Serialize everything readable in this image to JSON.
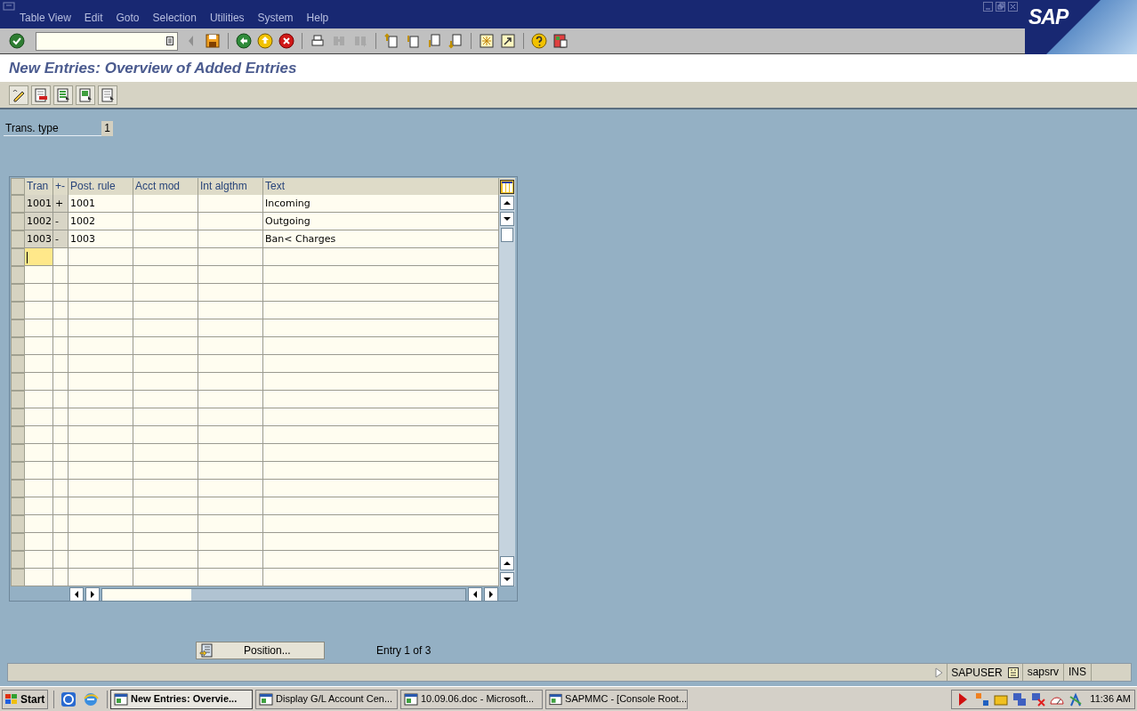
{
  "window": {
    "menu": [
      "Table View",
      "Edit",
      "Goto",
      "Selection",
      "Utilities",
      "System",
      "Help"
    ]
  },
  "logo": "SAP",
  "title": "New Entries: Overview of Added Entries",
  "header_field": {
    "label": "Trans. type",
    "value": "1"
  },
  "table": {
    "columns": [
      {
        "label": "Tran",
        "key": true,
        "values": [
          "1001",
          "1002",
          "1003"
        ]
      },
      {
        "label": "+-",
        "key": true,
        "values": [
          "+",
          "-",
          "-"
        ]
      },
      {
        "label": "Post. rule",
        "key": false,
        "values": [
          "1001",
          "1002",
          "1003"
        ]
      },
      {
        "label": "Acct mod",
        "key": false
      },
      {
        "label": "Int algthm",
        "key": false
      },
      {
        "label": "Text",
        "key": false,
        "values": [
          "Incoming",
          "Outgoing",
          "Ban< Charges"
        ]
      }
    ],
    "rows_filled": [
      true,
      true,
      true
    ],
    "new_row": {
      "focused": true
    }
  },
  "position_button": "Position...",
  "entry_info": "Entry 1 of 3",
  "status_bar": {
    "user": "SAPUSER",
    "server": "sapsrv",
    "mode": "INS"
  },
  "taskbar": {
    "start": "Start",
    "tasks": [
      {
        "label": "New Entries: Overvie...",
        "selected": true
      },
      {
        "label": "Display G/L Account Cen...",
        "selected": false
      },
      {
        "label": "10.09.06.doc - Microsoft...",
        "selected": false
      },
      {
        "label": "SAPMMC - [Console Root...",
        "selected": false
      }
    ],
    "clock": "11:36 AM"
  }
}
